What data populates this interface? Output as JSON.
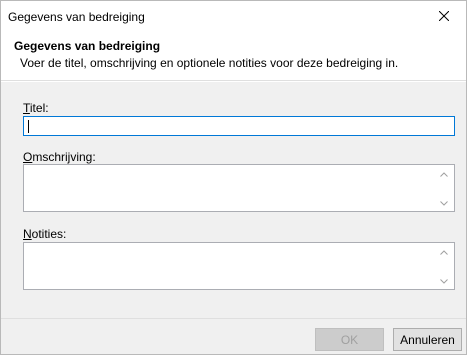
{
  "window": {
    "title": "Gegevens van bedreiging"
  },
  "header": {
    "title": "Gegevens van bedreiging",
    "description": "Voer de titel, omschrijving en optionele notities voor deze bedreiging in."
  },
  "form": {
    "titel": {
      "label_access": "T",
      "label_rest": "itel:",
      "value": ""
    },
    "omschrijving": {
      "label_access": "O",
      "label_rest": "mschrijving:",
      "value": ""
    },
    "notities": {
      "label_access": "N",
      "label_rest": "otities:",
      "value": ""
    }
  },
  "buttons": {
    "ok": "OK",
    "cancel": "Annuleren"
  },
  "icons": {
    "close": "close-icon",
    "scroll_up": "chevron-up-icon",
    "scroll_down": "chevron-down-icon"
  },
  "colors": {
    "focus_border": "#0078d7",
    "panel_bg": "#f0f0f0"
  }
}
